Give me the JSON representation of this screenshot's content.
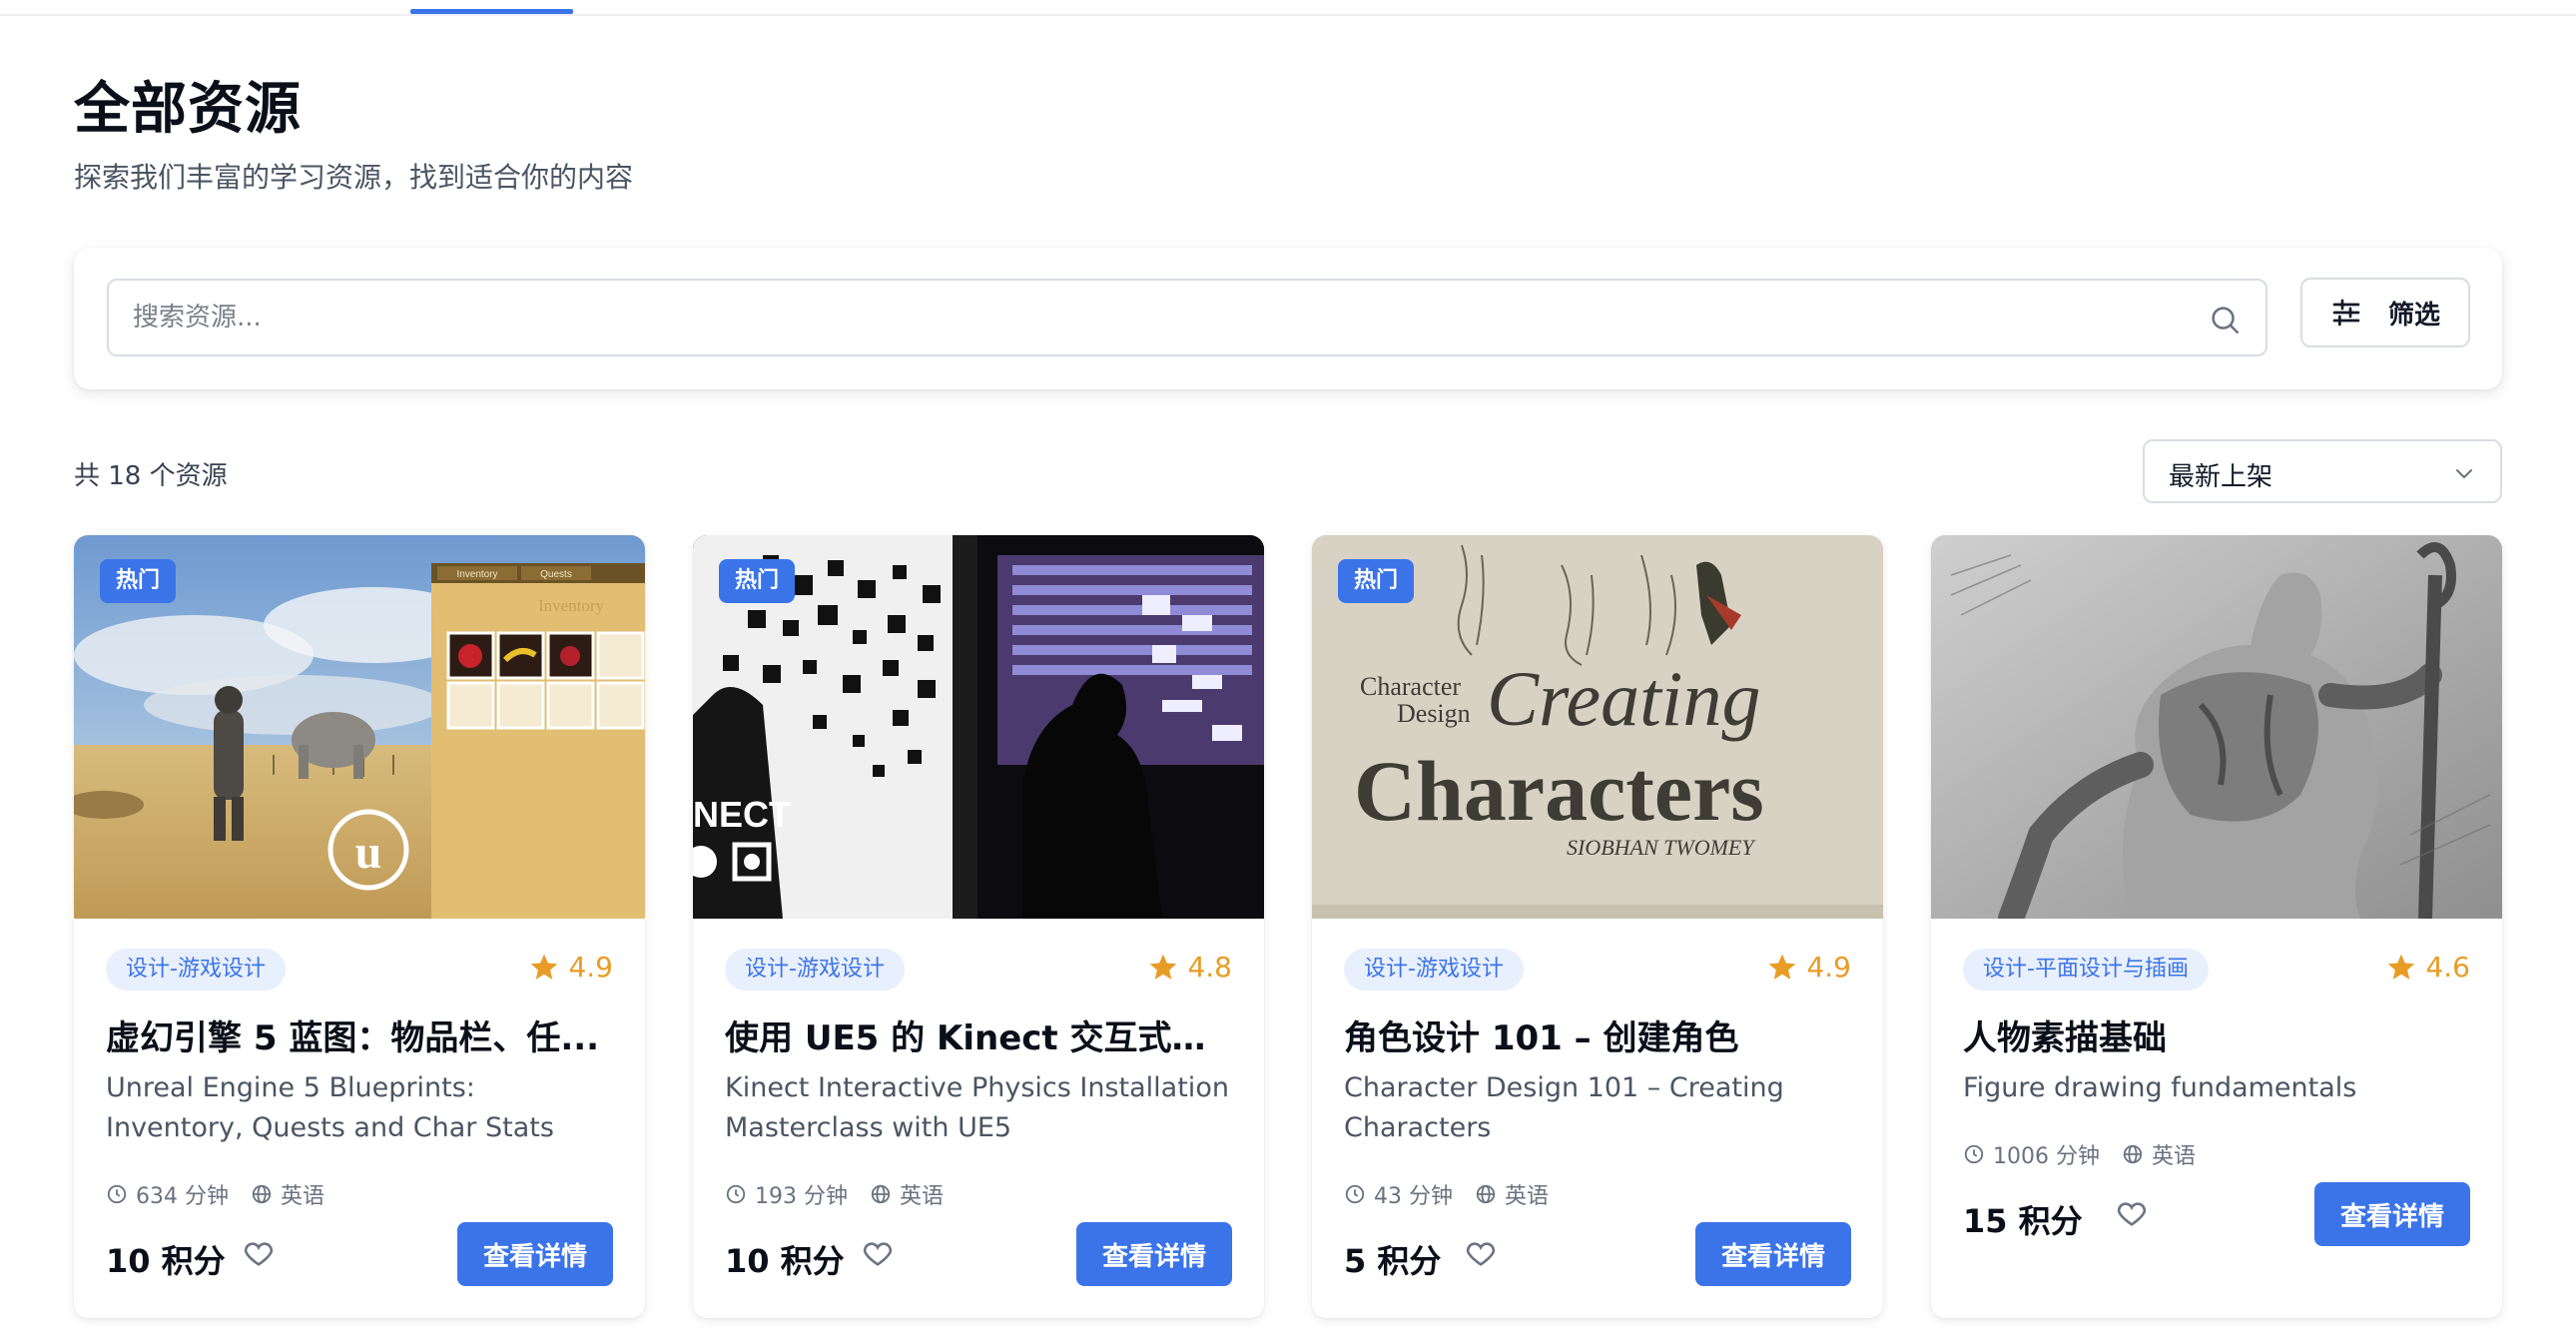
{
  "header": {
    "title": "全部资源",
    "subtitle": "探索我们丰富的学习资源，找到适合你的内容"
  },
  "search": {
    "placeholder": "搜索资源...",
    "value": "",
    "filter_label": "筛选"
  },
  "results": {
    "count_text": "共 18 个资源",
    "sort_selected": "最新上架"
  },
  "colors": {
    "accent": "#3b74e8",
    "star": "#e89c27",
    "tag_bg": "#e8effd"
  },
  "cards": [
    {
      "hot_badge": "热门",
      "category": "设计-游戏设计",
      "rating": "4.9",
      "title": "虚幻引擎 5 蓝图：物品栏、任...",
      "description": "Unreal Engine 5 Blueprints: Inventory, Quests and Char Stats",
      "duration": "634 分钟",
      "language": "英语",
      "price": "10 积分",
      "button_label": "查看详情",
      "thumb_text": {
        "inventory": "Inventory",
        "quests": "Quests",
        "inventory_big": "Inventory"
      }
    },
    {
      "hot_badge": "热门",
      "category": "设计-游戏设计",
      "rating": "4.8",
      "title": "使用 UE5 的 Kinect 交互式物...",
      "description": "Kinect Interactive Physics Installation Masterclass with UE5",
      "duration": "193 分钟",
      "language": "英语",
      "price": "10 积分",
      "button_label": "查看详情",
      "thumb_text": {
        "nect": "NECT"
      }
    },
    {
      "hot_badge": "热门",
      "category": "设计-游戏设计",
      "rating": "4.9",
      "title": "角色设计 101 – 创建角色",
      "description": "Character Design 101 – Creating Characters",
      "duration": "43 分钟",
      "language": "英语",
      "price": "5 积分",
      "button_label": "查看详情",
      "thumb_text": {
        "small1": "Character",
        "small2": "Design",
        "big1": "Creating",
        "big2": "Characters",
        "author": "SIOBHAN TWOMEY"
      }
    },
    {
      "hot_badge": "",
      "category": "设计-平面设计与插画",
      "rating": "4.6",
      "title": "人物素描基础",
      "description": "Figure drawing fundamentals",
      "duration": "1006 分钟",
      "language": "英语",
      "price": "15 积分",
      "button_label": "查看详情"
    }
  ]
}
